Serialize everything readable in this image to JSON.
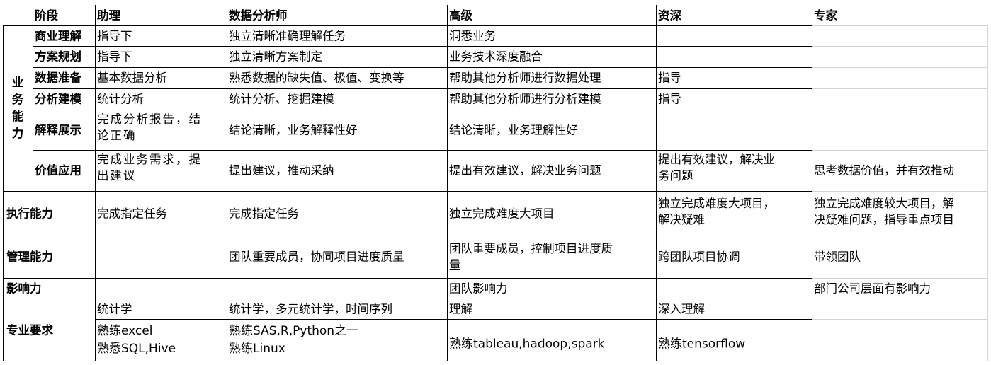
{
  "header": {
    "stage": "阶段",
    "assistant": "助理",
    "analyst": "数据分析师",
    "senior": "高级",
    "veteran": "资深",
    "expert": "专家"
  },
  "category_business": "业\n务\n能\n力",
  "rows": {
    "biz_understanding": {
      "label": "商业理解",
      "assistant": "指导下",
      "analyst": "独立清晰准确理解任务",
      "senior": "洞悉业务",
      "veteran": "",
      "expert": ""
    },
    "planning": {
      "label": "方案规划",
      "assistant": "指导下",
      "analyst": "独立清晰方案制定",
      "senior": "业务技术深度融合",
      "veteran": "",
      "expert": ""
    },
    "data_prep": {
      "label": "数据准备",
      "assistant": "基本数据分析",
      "analyst": "熟悉数据的缺失值、极值、变换等",
      "senior": "帮助其他分析师进行数据处理",
      "veteran": "指导",
      "expert": ""
    },
    "modeling": {
      "label": "分析建模",
      "assistant": "统计分析",
      "analyst": "统计分析、挖掘建模",
      "senior": "帮助其他分析师进行分析建模",
      "veteran": "指导",
      "expert": ""
    },
    "presentation": {
      "label": "解释展示",
      "assistant": "完成分析报告，结\n论正确",
      "analyst": "结论清晰，业务解释性好",
      "senior": "结论清晰，业务理解性好",
      "veteran": "",
      "expert": ""
    },
    "value": {
      "label": "价值应用",
      "assistant": "完成业务需求，提\n出建议",
      "analyst": "提出建议，推动采纳",
      "senior": "提出有效建议，解决业务问题",
      "veteran": "提出有效建议，解决业\n务问题",
      "expert": "思考数据价值，并有效推动"
    },
    "execution": {
      "label": "执行能力",
      "assistant": "完成指定任务",
      "analyst": "完成指定任务",
      "senior": "独立完成难度大项目",
      "veteran": "独立完成难度大项目，\n解决疑难",
      "expert": "独立完成难度较大项目，解\n决疑难问题，指导重点项目"
    },
    "management": {
      "label": "管理能力",
      "assistant": "",
      "analyst": "团队重要成员，协同项目进度质量",
      "senior": "团队重要成员，控制项目进度质\n量",
      "veteran": "跨团队项目协调",
      "expert": "带领团队"
    },
    "influence": {
      "label": "影响力",
      "assistant": "",
      "analyst": "",
      "senior": "团队影响力",
      "veteran": "",
      "expert": "部门公司层面有影响力"
    },
    "professional": {
      "label": "专业要求",
      "r1": {
        "assistant": "统计学",
        "analyst": "统计学，多元统计学，时间序列",
        "senior": "理解",
        "veteran": "深入理解",
        "expert": ""
      },
      "r2": {
        "assistant": "熟练excel\n熟悉SQL,Hive",
        "analyst": "熟练SAS,R,Python之一\n熟练Linux",
        "senior": "熟练tableau,hadoop,spark",
        "veteran": "熟练tensorflow",
        "expert": ""
      }
    }
  }
}
